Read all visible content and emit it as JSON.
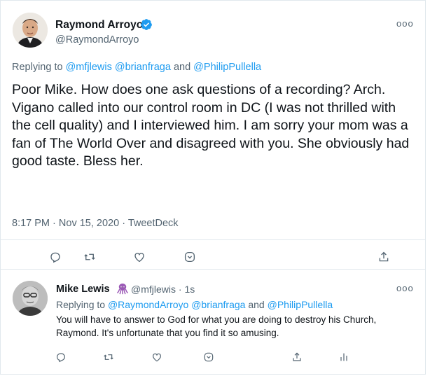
{
  "main_tweet": {
    "author": {
      "name": "Raymond Arroyo",
      "handle": "@RaymondArroyo",
      "verified": true
    },
    "replying_prefix": "Replying to",
    "replying_to": [
      "@mfjlewis",
      "@brianfraga",
      "@PhilipPullella"
    ],
    "replying_joiner": "and",
    "text": "Poor Mike. How does one ask questions of a recording? Arch. Vigano called into our control room in DC (I was not thrilled with the cell quality) and I interviewed him. I am sorry your mom was a fan of The World Over and disagreed with you. She obviously had good taste. Bless her.",
    "time": "8:17 PM",
    "date": "Nov 15, 2020",
    "source": "TweetDeck",
    "meta_separator": "·",
    "more_label": "ooo",
    "actions": [
      "reply-icon",
      "retweet-icon",
      "like-icon",
      "downvote-icon",
      "share-icon"
    ]
  },
  "reply_tweet": {
    "author": {
      "name": "Mike Lewis",
      "emoji": "octopus-icon",
      "handle": "@mfjlewis",
      "separator": "·",
      "time": "1s"
    },
    "replying_prefix": "Replying to",
    "replying_to": [
      "@RaymondArroyo",
      "@brianfraga",
      "@PhilipPullella"
    ],
    "replying_joiner": "and",
    "text": "You will have to answer to God for what you are doing to destroy his Church, Raymond. It's unfortunate that you find it so amusing.",
    "more_label": "ooo",
    "actions": [
      "reply-icon",
      "retweet-icon",
      "like-icon",
      "downvote-icon",
      "share-icon",
      "analytics-icon"
    ]
  },
  "colors": {
    "text": "#0f1419",
    "secondary": "#536471",
    "link": "#1d9bf0",
    "border": "#e1e8ed",
    "octopus": "#9b59b6"
  }
}
